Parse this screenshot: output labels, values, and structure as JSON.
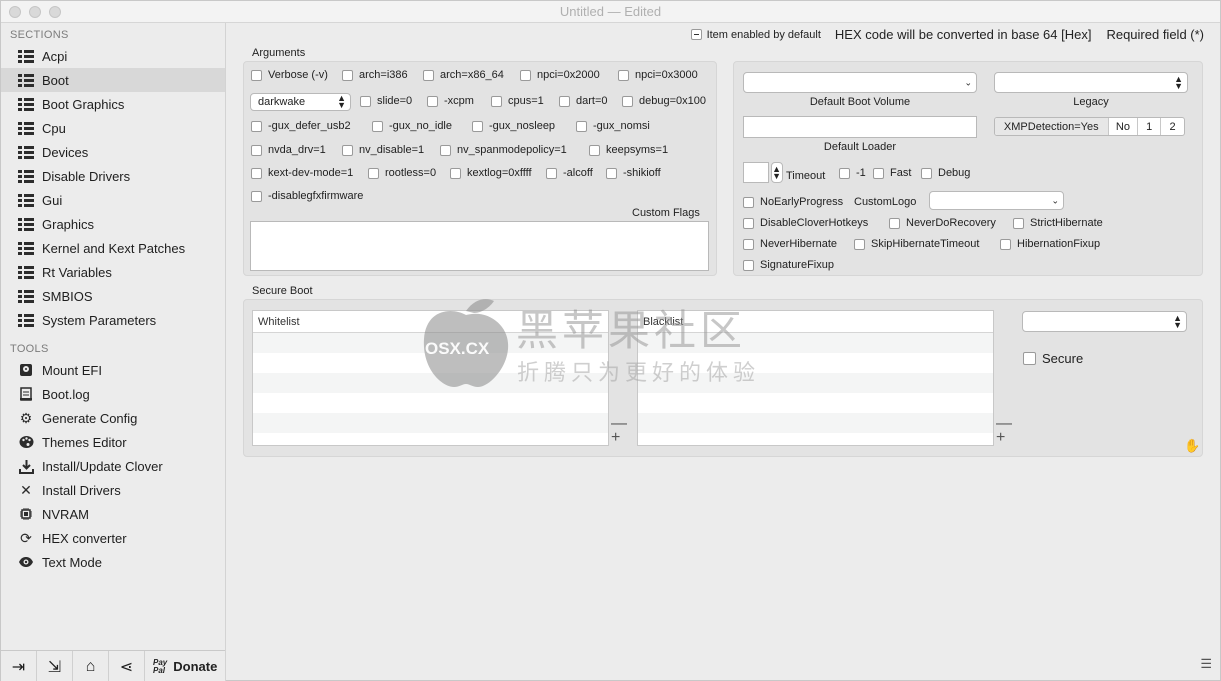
{
  "window": {
    "title": "Untitled",
    "status": "— Edited"
  },
  "sidebar": {
    "sections_heading": "SECTIONS",
    "tools_heading": "TOOLS",
    "sections": [
      {
        "label": "Acpi"
      },
      {
        "label": "Boot"
      },
      {
        "label": "Boot Graphics"
      },
      {
        "label": "Cpu"
      },
      {
        "label": "Devices"
      },
      {
        "label": "Disable Drivers"
      },
      {
        "label": "Gui"
      },
      {
        "label": "Graphics"
      },
      {
        "label": "Kernel and Kext Patches"
      },
      {
        "label": "Rt Variables"
      },
      {
        "label": "SMBIOS"
      },
      {
        "label": "System Parameters"
      }
    ],
    "selected_section": "Boot",
    "tools": [
      {
        "label": "Mount EFI",
        "icon": "disk-icon"
      },
      {
        "label": "Boot.log",
        "icon": "log-icon"
      },
      {
        "label": "Generate Config",
        "icon": "gears-icon"
      },
      {
        "label": "Themes Editor",
        "icon": "palette-icon"
      },
      {
        "label": "Install/Update Clover",
        "icon": "download-icon"
      },
      {
        "label": "Install Drivers",
        "icon": "wrench-icon"
      },
      {
        "label": "NVRAM",
        "icon": "chip-icon"
      },
      {
        "label": "HEX converter",
        "icon": "refresh-icon"
      },
      {
        "label": "Text Mode",
        "icon": "eye-icon"
      }
    ],
    "bottom": {
      "paypal_top": "Pay",
      "paypal_bottom": "Pal",
      "donate": "Donate"
    }
  },
  "topinfo": {
    "item_enabled": "Item enabled by default",
    "hex_note": "HEX code will be converted in base 64 [Hex]",
    "required": "Required field (*)"
  },
  "arguments": {
    "label": "Arguments",
    "row1": [
      "Verbose (-v)",
      "arch=i386",
      "arch=x86_64",
      "npci=0x2000",
      "npci=0x3000"
    ],
    "darkwake": "darkwake",
    "row2": [
      "slide=0",
      "-xcpm",
      "cpus=1",
      "dart=0",
      "debug=0x100"
    ],
    "row3": [
      "-gux_defer_usb2",
      "-gux_no_idle",
      "-gux_nosleep",
      "-gux_nomsi"
    ],
    "row4": [
      "nvda_drv=1",
      "nv_disable=1",
      "nv_spanmodepolicy=1",
      "keepsyms=1"
    ],
    "row5": [
      "kext-dev-mode=1",
      "rootless=0",
      "kextlog=0xffff",
      "-alcoff",
      "-shikioff"
    ],
    "row6": [
      "-disablegfxfirmware"
    ],
    "custom_flags": "Custom Flags"
  },
  "boot_right": {
    "default_boot_volume": "Default Boot Volume",
    "legacy": "Legacy",
    "default_loader": "Default Loader",
    "xmp_segments": [
      "XMPDetection=Yes",
      "No",
      "1",
      "2"
    ],
    "timeout": "Timeout",
    "minus_one": "-1",
    "fast": "Fast",
    "debug": "Debug",
    "no_early_progress": "NoEarlyProgress",
    "custom_logo": "CustomLogo",
    "checks_row1": [
      "DisableCloverHotkeys",
      "NeverDoRecovery",
      "StrictHibernate"
    ],
    "checks_row2": [
      "NeverHibernate",
      "SkipHibernateTimeout",
      "HibernationFixup"
    ],
    "checks_row3": [
      "SignatureFixup"
    ]
  },
  "secure_boot": {
    "label": "Secure Boot",
    "whitelist": "Whitelist",
    "blacklist": "Blacklist",
    "secure": "Secure",
    "minus": "—",
    "plus": "+"
  },
  "watermark": {
    "big": "黑苹果社区",
    "small": "折腾只为更好的体验",
    "site": "OSX.CX"
  }
}
